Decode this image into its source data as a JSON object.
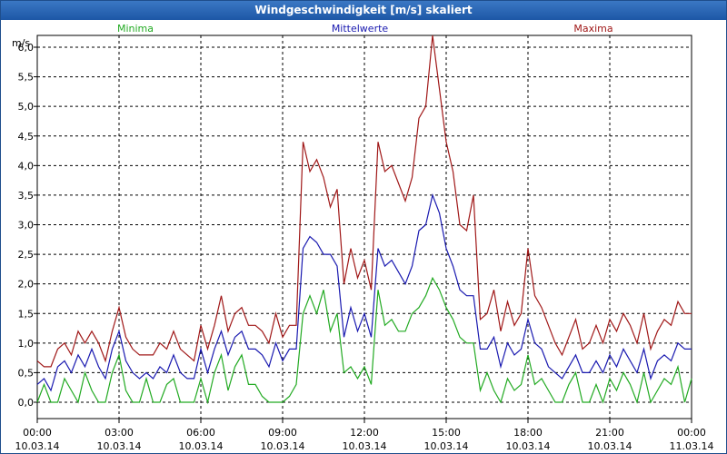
{
  "window": {
    "title": "Windgeschwindigkeit [m/s] skaliert"
  },
  "chart_data": {
    "type": "line",
    "title": "Windgeschwindigkeit [m/s] skaliert",
    "ylabel": "m/s",
    "ylim": [
      -0.3,
      6.5
    ],
    "yticks": [
      "0,0",
      "0,5",
      "1,0",
      "1,5",
      "2,0",
      "2,5",
      "3,0",
      "3,5",
      "4,0",
      "4,5",
      "5,0",
      "5,5",
      "6,0"
    ],
    "xtick_times": [
      "00:00",
      "03:00",
      "06:00",
      "09:00",
      "12:00",
      "15:00",
      "18:00",
      "21:00",
      "00:00"
    ],
    "xtick_dates": [
      "10.03.14",
      "10.03.14",
      "10.03.14",
      "10.03.14",
      "10.03.14",
      "10.03.14",
      "10.03.14",
      "10.03.14",
      "11.03.14"
    ],
    "x_unit": "hours from 00:00 10.03.14",
    "grid": true,
    "legend": [
      {
        "name": "Minima",
        "color": "#22aa22"
      },
      {
        "name": "Mittelwerte",
        "color": "#1a1ab0"
      },
      {
        "name": "Maxima",
        "color": "#a01818"
      }
    ],
    "x": [
      0,
      0.25,
      0.5,
      0.75,
      1,
      1.25,
      1.5,
      1.75,
      2,
      2.25,
      2.5,
      2.75,
      3,
      3.25,
      3.5,
      3.75,
      4,
      4.25,
      4.5,
      4.75,
      5,
      5.25,
      5.5,
      5.75,
      6,
      6.25,
      6.5,
      6.75,
      7,
      7.25,
      7.5,
      7.75,
      8,
      8.25,
      8.5,
      8.75,
      9,
      9.25,
      9.5,
      9.75,
      10,
      10.25,
      10.5,
      10.75,
      11,
      11.25,
      11.5,
      11.75,
      12,
      12.25,
      12.5,
      12.75,
      13,
      13.25,
      13.5,
      13.75,
      14,
      14.25,
      14.5,
      14.75,
      15,
      15.25,
      15.5,
      15.75,
      16,
      16.25,
      16.5,
      16.75,
      17,
      17.25,
      17.5,
      17.75,
      18,
      18.25,
      18.5,
      18.75,
      19,
      19.25,
      19.5,
      19.75,
      20,
      20.25,
      20.5,
      20.75,
      21,
      21.25,
      21.5,
      21.75,
      22,
      22.25,
      22.5,
      22.75,
      23,
      23.25,
      23.5,
      23.75,
      24
    ],
    "series": [
      {
        "name": "Maxima",
        "color": "#a01818",
        "values": [
          0.7,
          0.6,
          0.6,
          0.9,
          1.0,
          0.8,
          1.2,
          1.0,
          1.2,
          1.0,
          0.7,
          1.2,
          1.6,
          1.1,
          0.9,
          0.8,
          0.8,
          0.8,
          1.0,
          0.9,
          1.2,
          0.9,
          0.8,
          0.7,
          1.3,
          0.9,
          1.3,
          1.8,
          1.2,
          1.5,
          1.6,
          1.3,
          1.3,
          1.2,
          1.0,
          1.5,
          1.1,
          1.3,
          1.3,
          4.4,
          3.9,
          4.1,
          3.8,
          3.3,
          3.6,
          2.0,
          2.6,
          2.1,
          2.4,
          1.9,
          4.4,
          3.9,
          4.0,
          3.7,
          3.4,
          3.8,
          4.8,
          5.0,
          6.2,
          5.3,
          4.4,
          3.9,
          3.0,
          2.9,
          3.5,
          1.4,
          1.5,
          1.9,
          1.2,
          1.7,
          1.3,
          1.5,
          2.6,
          1.8,
          1.6,
          1.3,
          1.0,
          0.8,
          1.1,
          1.4,
          0.9,
          1.0,
          1.3,
          1.0,
          1.4,
          1.2,
          1.5,
          1.3,
          1.0,
          1.5,
          0.9,
          1.2,
          1.4,
          1.3,
          1.7,
          1.5,
          1.5
        ]
      },
      {
        "name": "Mittelwerte",
        "color": "#1a1ab0",
        "values": [
          0.3,
          0.4,
          0.2,
          0.6,
          0.7,
          0.5,
          0.8,
          0.6,
          0.9,
          0.6,
          0.4,
          0.9,
          1.2,
          0.7,
          0.5,
          0.4,
          0.5,
          0.4,
          0.6,
          0.5,
          0.8,
          0.5,
          0.4,
          0.4,
          0.9,
          0.5,
          0.9,
          1.2,
          0.8,
          1.1,
          1.2,
          0.9,
          0.9,
          0.8,
          0.6,
          1.0,
          0.7,
          0.9,
          0.9,
          2.6,
          2.8,
          2.7,
          2.5,
          2.5,
          2.3,
          1.1,
          1.6,
          1.2,
          1.5,
          1.1,
          2.6,
          2.3,
          2.4,
          2.2,
          2.0,
          2.3,
          2.9,
          3.0,
          3.5,
          3.2,
          2.6,
          2.3,
          1.9,
          1.8,
          1.8,
          0.9,
          0.9,
          1.1,
          0.6,
          1.0,
          0.8,
          0.9,
          1.4,
          1.0,
          0.9,
          0.6,
          0.5,
          0.4,
          0.6,
          0.8,
          0.5,
          0.5,
          0.7,
          0.5,
          0.8,
          0.6,
          0.9,
          0.7,
          0.5,
          0.9,
          0.4,
          0.7,
          0.8,
          0.7,
          1.0,
          0.9,
          0.9
        ]
      },
      {
        "name": "Minima",
        "color": "#22aa22",
        "values": [
          0.0,
          0.3,
          0.0,
          0.0,
          0.4,
          0.2,
          0.0,
          0.5,
          0.2,
          0.0,
          0.0,
          0.5,
          0.8,
          0.2,
          0.0,
          0.0,
          0.4,
          0.0,
          0.0,
          0.3,
          0.4,
          0.0,
          0.0,
          0.0,
          0.4,
          0.0,
          0.5,
          0.8,
          0.2,
          0.6,
          0.8,
          0.3,
          0.3,
          0.1,
          0.0,
          0.0,
          0.0,
          0.1,
          0.3,
          1.5,
          1.8,
          1.5,
          1.9,
          1.2,
          1.5,
          0.5,
          0.6,
          0.4,
          0.6,
          0.3,
          1.9,
          1.3,
          1.4,
          1.2,
          1.2,
          1.5,
          1.6,
          1.8,
          2.1,
          1.9,
          1.6,
          1.4,
          1.1,
          1.0,
          1.0,
          0.2,
          0.5,
          0.2,
          0.0,
          0.4,
          0.2,
          0.3,
          0.8,
          0.3,
          0.4,
          0.2,
          0.0,
          0.0,
          0.3,
          0.5,
          0.0,
          0.0,
          0.3,
          0.0,
          0.4,
          0.2,
          0.5,
          0.3,
          0.0,
          0.5,
          0.0,
          0.2,
          0.4,
          0.3,
          0.6,
          0.0,
          0.4
        ]
      }
    ]
  }
}
